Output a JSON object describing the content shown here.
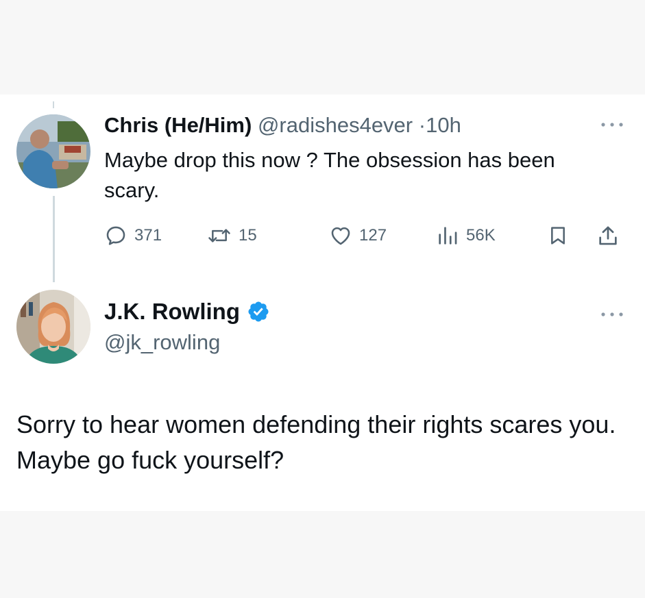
{
  "reply_tweet": {
    "display_name": "Chris (He/Him)",
    "handle": "@radishes4ever",
    "separator": "·",
    "time": "10h",
    "text": "Maybe drop this now ? The obsession has been scary.",
    "more_icon": "more-dots-icon",
    "actions": {
      "replies": "371",
      "retweets": "15",
      "likes": "127",
      "views": "56K"
    }
  },
  "main_tweet": {
    "display_name": "J.K. Rowling",
    "handle": "@jk_rowling",
    "verified": true,
    "text": "Sorry to hear women defending their rights scares you. Maybe go fuck yourself?",
    "more_icon": "more-dots-icon"
  },
  "colors": {
    "text": "#0f1419",
    "muted": "#536471",
    "verified_blue": "#1d9bf0",
    "thread_line": "#cfd9de",
    "page_background": "#f7f7f7",
    "card_background": "#ffffff"
  }
}
